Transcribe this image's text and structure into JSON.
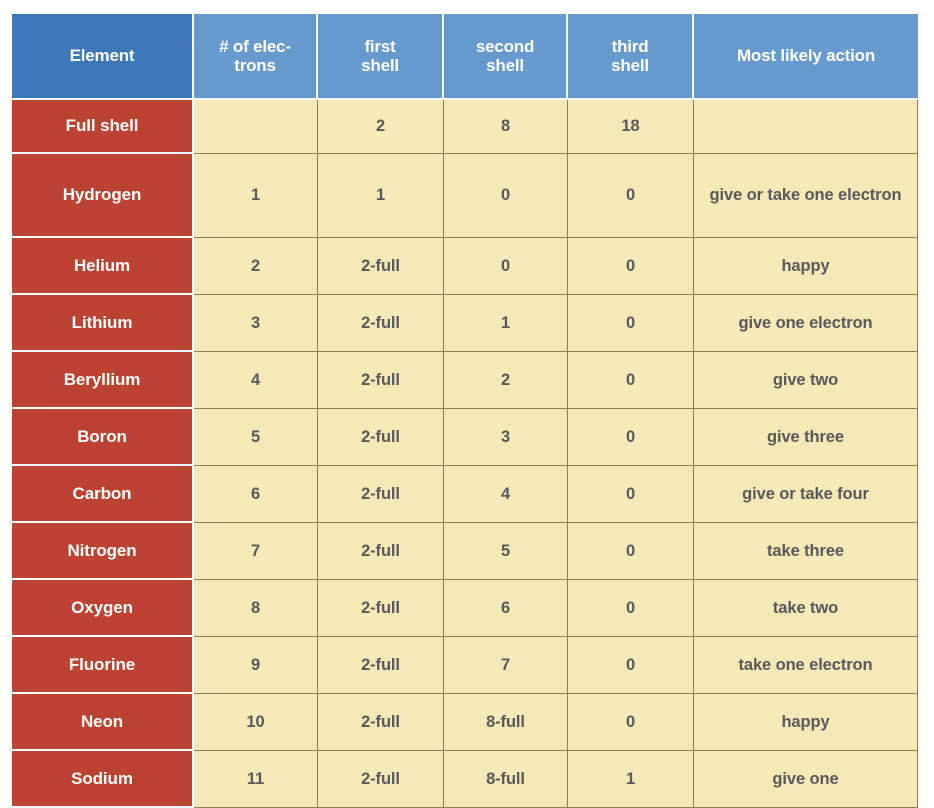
{
  "table": {
    "name": "electron-shell-table",
    "columns": [
      {
        "key": "element",
        "label": "Element"
      },
      {
        "key": "electrons",
        "label": "# of elec-\ntrons"
      },
      {
        "key": "first_shell",
        "label": "first\nshell"
      },
      {
        "key": "second_shell",
        "label": "second\nshell"
      },
      {
        "key": "third_shell",
        "label": "third\nshell"
      },
      {
        "key": "action",
        "label": "Most likely action"
      }
    ],
    "header_labels": {
      "element": "Element",
      "electrons_line1": "# of elec-",
      "electrons_line2": "trons",
      "first_line1": "first",
      "first_line2": "shell",
      "second_line1": "second",
      "second_line2": "shell",
      "third_line1": "third",
      "third_line2": "shell",
      "action": "Most likely action"
    },
    "rows": [
      {
        "element": "Full shell",
        "electrons": "",
        "first_shell": "2",
        "second_shell": "8",
        "third_shell": "18",
        "action": ""
      },
      {
        "element": "Hydrogen",
        "electrons": "1",
        "first_shell": "1",
        "second_shell": "0",
        "third_shell": "0",
        "action": "give or take one electron"
      },
      {
        "element": "Helium",
        "electrons": "2",
        "first_shell": "2-full",
        "second_shell": "0",
        "third_shell": "0",
        "action": "happy"
      },
      {
        "element": "Lithium",
        "electrons": "3",
        "first_shell": "2-full",
        "second_shell": "1",
        "third_shell": "0",
        "action": "give one electron"
      },
      {
        "element": "Beryllium",
        "electrons": "4",
        "first_shell": "2-full",
        "second_shell": "2",
        "third_shell": "0",
        "action": "give two"
      },
      {
        "element": "Boron",
        "electrons": "5",
        "first_shell": "2-full",
        "second_shell": "3",
        "third_shell": "0",
        "action": "give three"
      },
      {
        "element": "Carbon",
        "electrons": "6",
        "first_shell": "2-full",
        "second_shell": "4",
        "third_shell": "0",
        "action": "give or take four"
      },
      {
        "element": "Nitrogen",
        "electrons": "7",
        "first_shell": "2-full",
        "second_shell": "5",
        "third_shell": "0",
        "action": "take three"
      },
      {
        "element": "Oxygen",
        "electrons": "8",
        "first_shell": "2-full",
        "second_shell": "6",
        "third_shell": "0",
        "action": "take two"
      },
      {
        "element": "Fluorine",
        "electrons": "9",
        "first_shell": "2-full",
        "second_shell": "7",
        "third_shell": "0",
        "action": "take one electron"
      },
      {
        "element": "Neon",
        "electrons": "10",
        "first_shell": "2-full",
        "second_shell": "8-full",
        "third_shell": "0",
        "action": "happy"
      },
      {
        "element": "Sodium",
        "electrons": "11",
        "first_shell": "2-full",
        "second_shell": "8-full",
        "third_shell": "1",
        "action": "give one"
      }
    ]
  },
  "colors": {
    "header_element": "#3d77b8",
    "header_other": "#6699cc",
    "element_cell": "#bc4232",
    "data_cell": "#f5e9b8",
    "grid_line": "#8a7f55",
    "data_text": "#595959",
    "header_text": "#ffffff",
    "page_background": "#ffffff"
  }
}
